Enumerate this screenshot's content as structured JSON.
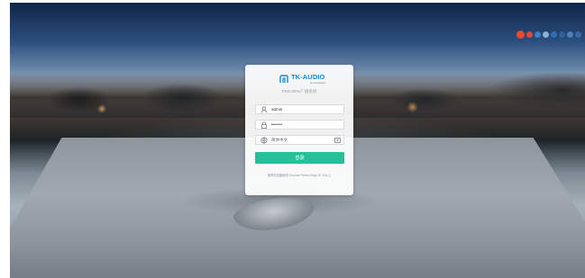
{
  "app": {
    "brand_name": "TK-AUDIO",
    "brand_sub": "by Honeywell",
    "subtitle": "PREVIEW广播系统"
  },
  "login": {
    "username": "admin",
    "password_masked": "••••••",
    "language": "简体中文",
    "submit_label": "登录",
    "browser_hint": "推荐浏览器使用 Chrome Firefox Edge IE 10以上"
  },
  "colors": {
    "accent": "#24c29a",
    "brand": "#1c86d0"
  },
  "icons": {
    "username": "user-icon",
    "password": "lock-icon",
    "language": "globe-icon",
    "dropdown": "chevron-down-icon"
  }
}
